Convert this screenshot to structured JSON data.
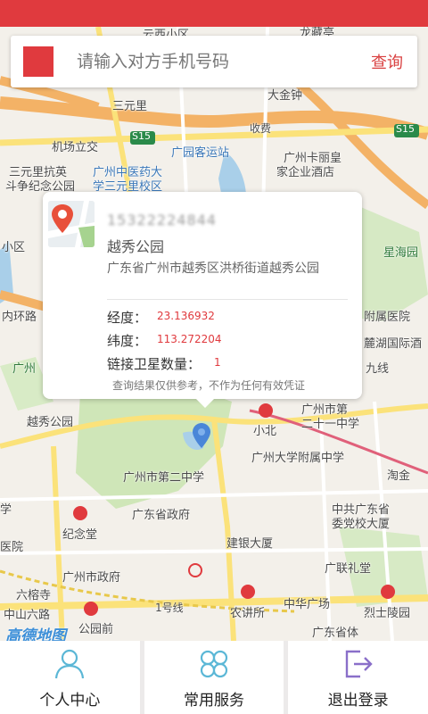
{
  "search": {
    "placeholder": "请输入对方手机号码",
    "value": "",
    "query_label": "查询"
  },
  "result": {
    "phone": "15322224844",
    "place_name": "越秀公园",
    "address": "广东省广州市越秀区洪桥街道越秀公园",
    "latitude_label": "经度：",
    "latitude_value": "23.136932",
    "longitude_label": "纬度：",
    "longitude_value": "113.272204",
    "satellites_label": "链接卫星数量：",
    "satellites_value": "1",
    "disclaimer": "查询结果仅供参考，不作为任何有效凭证"
  },
  "map": {
    "provider": "高德地图",
    "labels": {
      "yunxi": "云西小区",
      "longmiao": "龙藏亭",
      "dajinzhong": "大金钟",
      "sanyuanli": "三元里",
      "jichang": "机场立交",
      "s15a": "S15",
      "s15b": "S15",
      "shoufei": "收费",
      "guangyuan": "广园客运站",
      "kali": "广州卡丽皇",
      "jiaju": "家企业酒店",
      "sanyuanli_kang": "三元里抗英",
      "douzheng": "斗争纪念公园",
      "zhongyiyao": "广州中医药大",
      "sanyuanli_xq": "学三元里校区",
      "xiaoqu": "小区",
      "xinghai": "星海园",
      "huanlu": "内环路",
      "fushu": "附属医院",
      "lvhu": "麓湖国际酒",
      "guangzhou": "广州",
      "jiuxian": "九线",
      "yuexiu_gy": "越秀公园",
      "xiaobei": "小北",
      "guangzhou_shi": "广州市第",
      "ershiyi": "二十一中学",
      "fuzhong": "广州大学附属中学",
      "dier": "广州市第二中学",
      "taojin": "淘金",
      "shengfu": "广东省政府",
      "shengwei": "中共广东省",
      "dangxiao": "委党校大厦",
      "jinian": "纪念堂",
      "jianyin": "建银大厦",
      "liyi": "广联礼堂",
      "shifu": "广州市政府",
      "liuyong": "六榕寺",
      "zhongshan": "中山六路",
      "yihao": "1号线",
      "nongjiang": "农讲所",
      "zhonghua": "中华广场",
      "lieshi": "烈士陵园",
      "gongyuanqian": "公园前",
      "shengti": "广东省体",
      "yiyuan": "医院",
      "xue": "学"
    }
  },
  "nav": {
    "personal": "个人中心",
    "services": "常用服务",
    "logout": "退出登录"
  },
  "colors": {
    "brand_red": "#e03a3e",
    "nav_icon": "#5bb7d6",
    "logout_icon": "#8a6fc9"
  }
}
